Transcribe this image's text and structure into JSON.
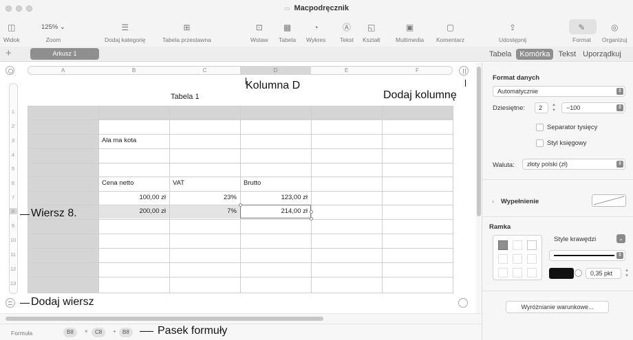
{
  "window": {
    "title": "Macpodręcznik"
  },
  "toolbar": {
    "view_label": "Widok",
    "zoom_value": "125% ⌄",
    "zoom_label": "Zoom",
    "add_category_label": "Dodaj kategorię",
    "pivot_label": "Tabela przestawna",
    "insert_label": "Wstaw",
    "table_label": "Tabela",
    "chart_label": "Wykres",
    "text_label": "Tekst",
    "shape_label": "Kształt",
    "media_label": "Multimedia",
    "comment_label": "Komentarz",
    "share_label": "Udostępnij",
    "format_label": "Format",
    "organize_label": "Organizuj"
  },
  "sheet_tabs": {
    "add": "+",
    "active": "Arkusz 1"
  },
  "inspector_tabs": [
    "Tabela",
    "Komórka",
    "Tekst",
    "Uporządkuj"
  ],
  "table": {
    "title": "Tabela 1",
    "columns": [
      "A",
      "B",
      "C",
      "D",
      "E",
      "F"
    ],
    "rows": [
      "1",
      "2",
      "3",
      "4",
      "5",
      "6",
      "7",
      "8",
      "9",
      "10",
      "11",
      "12",
      "13"
    ],
    "cells": {
      "b3": "Ala ma kota",
      "b6": "Cena netto",
      "c6": "VAT",
      "d6": "Brutto",
      "b7": "100,00 zł",
      "c7": "23%",
      "d7": "123,00 zł",
      "b8": "200,00 zł",
      "c8": "7%",
      "d8": "214,00 zł"
    }
  },
  "formula_bar": {
    "label": "Formuła",
    "tokens": [
      "B8",
      "×",
      "C8",
      "+",
      "B8"
    ]
  },
  "annotations": {
    "column": "Kolumna D",
    "add_column": "Dodaj kolumnę",
    "row": "Wiersz 8.",
    "add_row": "Dodaj wiersz",
    "formula_bar": "Pasek formuły"
  },
  "inspector": {
    "data_format_title": "Format danych",
    "data_format_value": "Automatycznie",
    "decimals_label": "Dziesiętne:",
    "decimals_value": "2",
    "negative_value": "−100",
    "thousands_separator": "Separator tysięcy",
    "accounting_style": "Styl księgowy",
    "currency_label": "Waluta:",
    "currency_value": "złoty polski (zł)",
    "fill_label": "Wypełnienie",
    "border_title": "Ramka",
    "border_styles": "Style krawędzi",
    "border_width": "0,35 pkt",
    "conditional": "Wyróżnianie warunkowe..."
  },
  "colors": {
    "header_fill": "#d5d5d5",
    "selection": "#e4e4e4",
    "accent_gray": "#8f8f8f"
  }
}
